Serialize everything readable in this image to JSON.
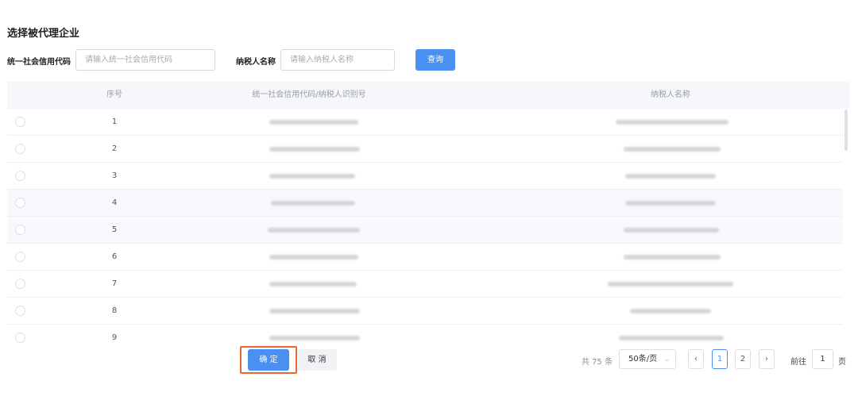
{
  "page": {
    "title": "选择被代理企业"
  },
  "filters": {
    "credit_code_label": "统一社会信用代码",
    "credit_code_placeholder": "请输入统一社会信用代码",
    "taxpayer_name_label": "纳税人名称",
    "taxpayer_name_placeholder": "请输入纳税人名称",
    "search_label": "查询"
  },
  "table": {
    "columns": [
      "序号",
      "统一社会信用代码/纳税人识别号",
      "纳税人名称"
    ],
    "rows": [
      {
        "index": "1"
      },
      {
        "index": "2"
      },
      {
        "index": "3"
      },
      {
        "index": "4"
      },
      {
        "index": "5"
      },
      {
        "index": "6"
      },
      {
        "index": "7"
      },
      {
        "index": "8"
      },
      {
        "index": "9"
      }
    ]
  },
  "actions": {
    "confirm_label": "确 定",
    "cancel_label": "取 消"
  },
  "pagination": {
    "total_text": "共 75 条",
    "page_size": "50条/页",
    "pages": [
      "1",
      "2"
    ],
    "current_page": "1",
    "goto_label": "前往",
    "goto_value": "1",
    "page_suffix": "页"
  },
  "colors": {
    "primary": "#4a90f0",
    "highlight_frame": "#e8682f"
  },
  "icons": {
    "prev": "chevron-left-icon",
    "next": "chevron-right-icon",
    "dropdown": "chevron-down-icon"
  }
}
